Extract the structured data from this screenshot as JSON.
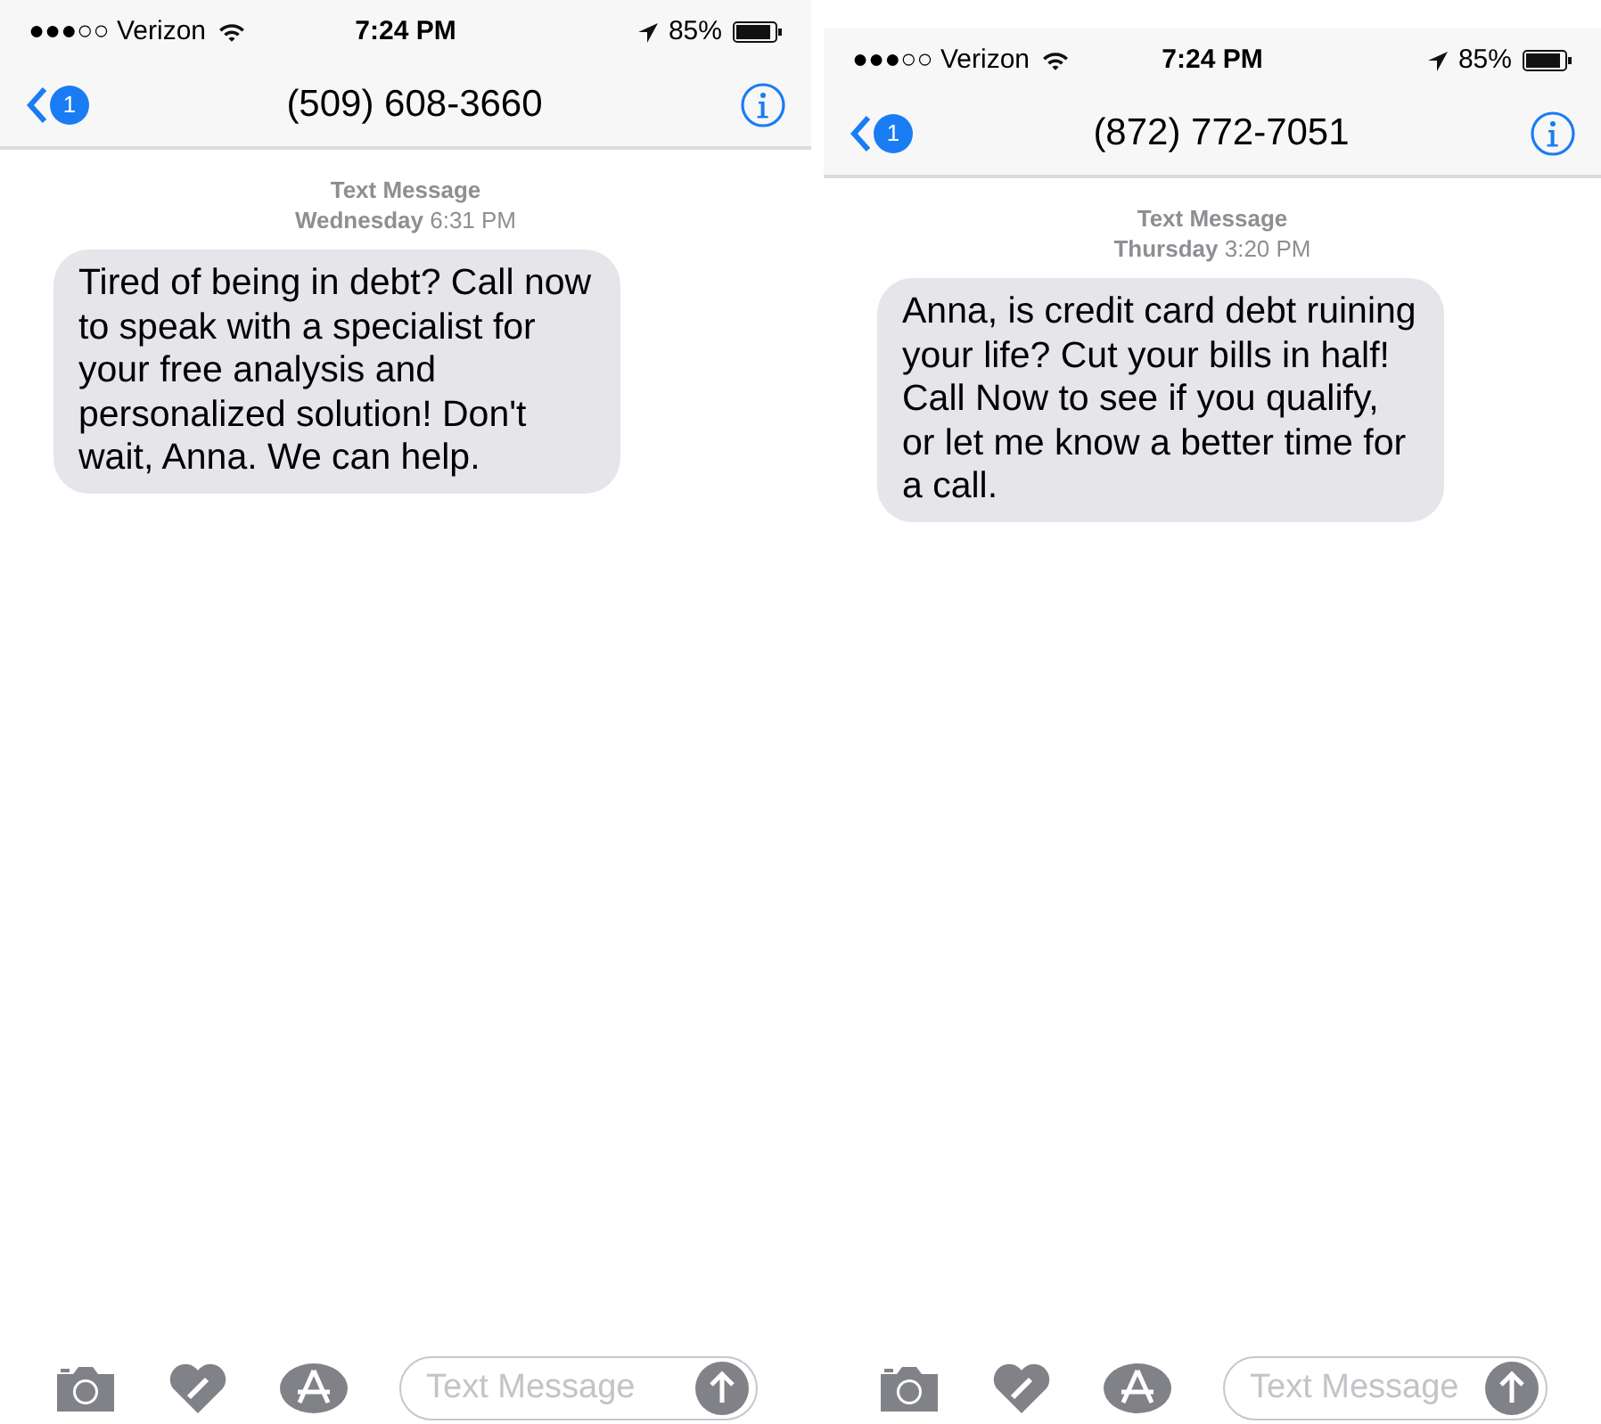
{
  "phones": [
    {
      "status_bar": {
        "carrier": "●●●○○ Verizon",
        "time": "7:24 PM",
        "battery": "85%"
      },
      "nav": {
        "back_badge": "1",
        "title": "(509) 608-3660"
      },
      "thread": {
        "service": "Text Message",
        "timestamp": "**Wednesday** 6:31 PM",
        "messages": [
          "Tired of being in debt? Call now to speak with a specialist for your free analysis and personalized solution! Don't wait, Anna. We can help."
        ]
      },
      "composer": {
        "placeholder": "Text Message"
      }
    },
    {
      "status_bar": {
        "carrier": "●●●○○ Verizon",
        "time": "7:24 PM",
        "battery": "85%"
      },
      "nav": {
        "back_badge": "1",
        "title": "(872) 772-7051"
      },
      "thread": {
        "service": "Text Message",
        "timestamp": "**Thursday** 3:20 PM",
        "messages": [
          "Anna, is credit card debt ruining your life? Cut your bills in half! Call Now to see if you qualify, or let me know a better time for a call."
        ]
      },
      "composer": {
        "placeholder": "Text Message"
      }
    }
  ]
}
